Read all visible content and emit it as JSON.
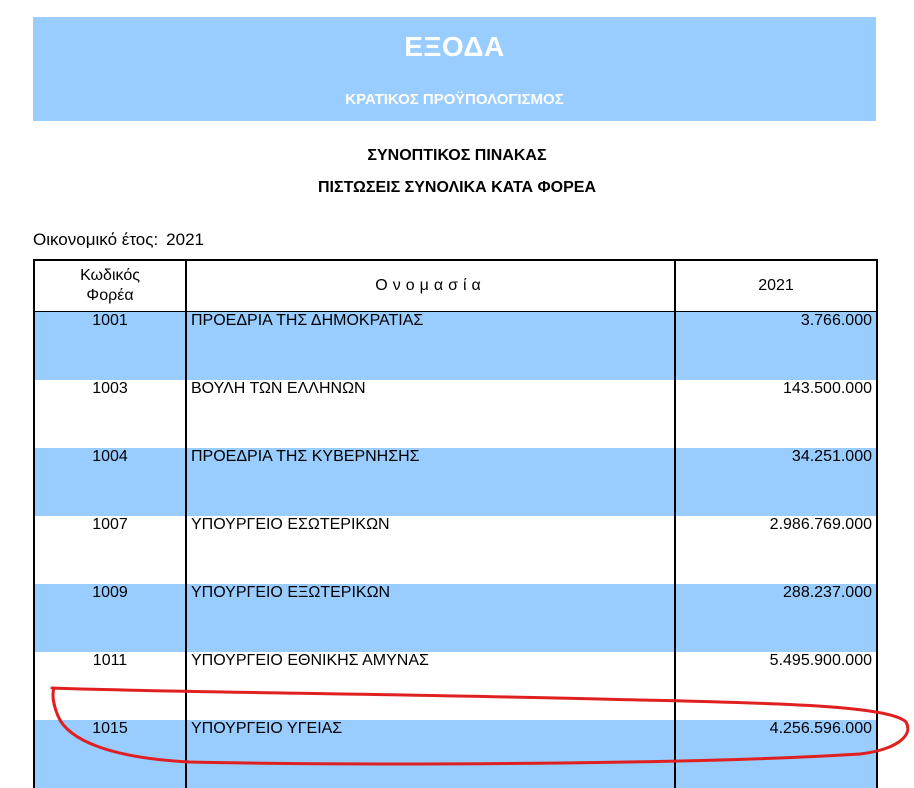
{
  "banner": {
    "title": "ΕΞΟΔΑ",
    "subtitle": "ΚΡΑΤΙΚΟΣ ΠΡΟΫΠΟΛΟΓΙΣΜΟΣ"
  },
  "headings": {
    "line1": "ΣΥΝΟΠΤΙΚΟΣ ΠΙΝΑΚΑΣ",
    "line2": "ΠΙΣΤΩΣΕΙΣ ΣΥΝΟΛΙΚΑ ΚΑΤΑ ΦΟΡΕΑ"
  },
  "fiscal_year": {
    "label": "Οικονομικό έτος:",
    "value": "2021"
  },
  "table": {
    "headers": {
      "code_line1": "Κωδικός",
      "code_line2": "Φορέα",
      "name": "Ονομασία",
      "amount": "2021"
    },
    "rows": [
      {
        "code": "1001",
        "name": "ΠΡΟΕΔΡΙΑ ΤΗΣ ΔΗΜΟΚΡΑΤΙΑΣ",
        "amount": "3.766.000"
      },
      {
        "code": "1003",
        "name": "ΒΟΥΛΗ ΤΩΝ ΕΛΛΗΝΩΝ",
        "amount": "143.500.000"
      },
      {
        "code": "1004",
        "name": "ΠΡΟΕΔΡΙΑ ΤΗΣ ΚΥΒΕΡΝΗΣΗΣ",
        "amount": "34.251.000"
      },
      {
        "code": "1007",
        "name": "ΥΠΟΥΡΓΕΙΟ ΕΣΩΤΕΡΙΚΩΝ",
        "amount": "2.986.769.000"
      },
      {
        "code": "1009",
        "name": "ΥΠΟΥΡΓΕΙΟ ΕΞΩΤΕΡΙΚΩΝ",
        "amount": "288.237.000"
      },
      {
        "code": "1011",
        "name": "ΥΠΟΥΡΓΕΙΟ ΕΘΝΙΚΗΣ ΑΜΥΝΑΣ",
        "amount": "5.495.900.000"
      },
      {
        "code": "1015",
        "name": "ΥΠΟΥΡΓΕΙΟ ΥΓΕΙΑΣ",
        "amount": "4.256.596.000"
      }
    ]
  },
  "colors": {
    "banner": "#99ccff",
    "row_highlight": "#99ccff",
    "annotation": "#e02020"
  }
}
